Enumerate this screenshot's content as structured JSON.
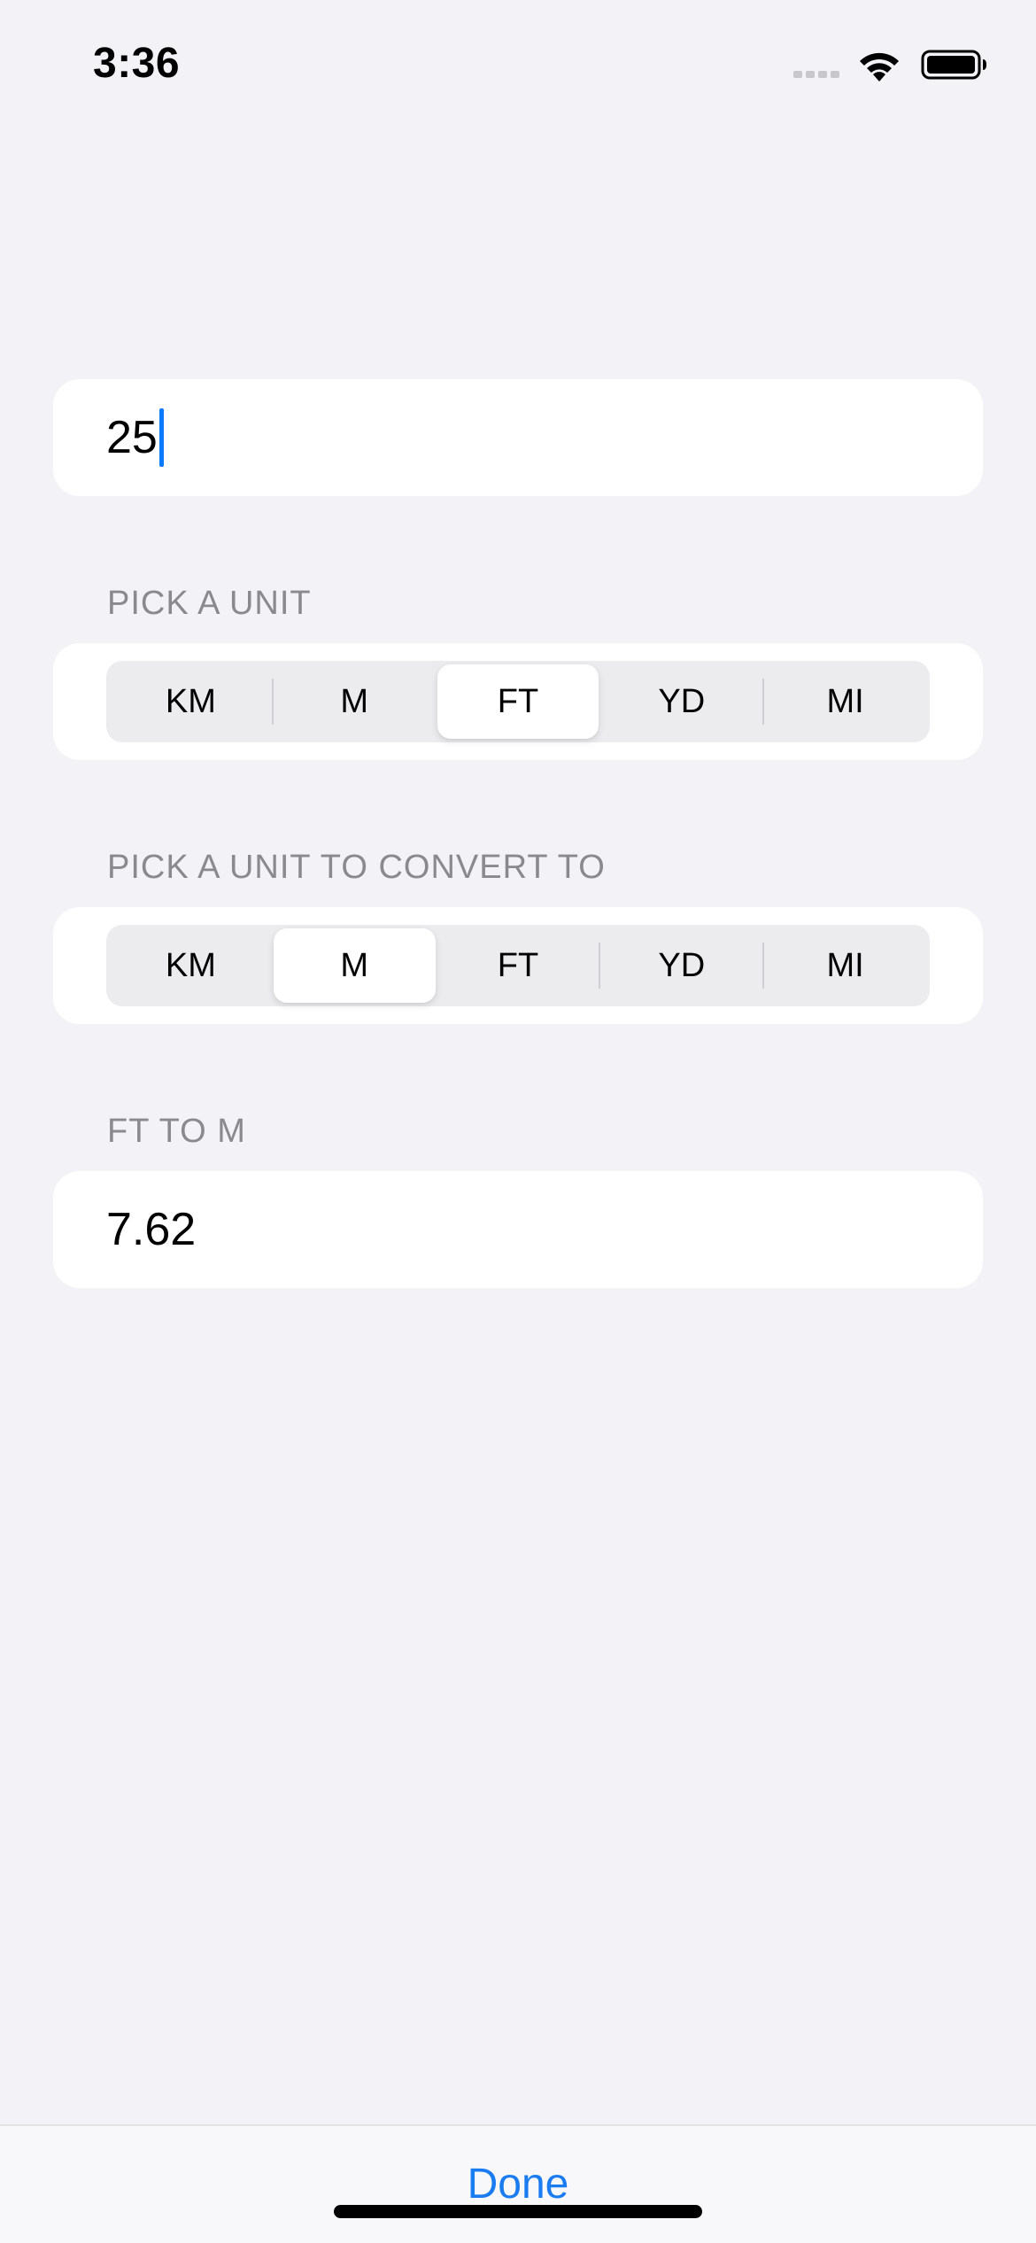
{
  "status_bar": {
    "time": "3:36",
    "icons": [
      "cellular-signal-icon",
      "wifi-icon",
      "battery-icon"
    ]
  },
  "input": {
    "value": "25"
  },
  "from_unit": {
    "header": "PICK A UNIT",
    "options": [
      "KM",
      "M",
      "FT",
      "YD",
      "MI"
    ],
    "selected": "FT"
  },
  "to_unit": {
    "header": "PICK A UNIT TO CONVERT TO",
    "options": [
      "KM",
      "M",
      "FT",
      "YD",
      "MI"
    ],
    "selected": "M"
  },
  "result": {
    "header": "FT TO M",
    "value": "7.62"
  },
  "toolbar": {
    "done_label": "Done"
  },
  "colors": {
    "background": "#f2f2f7",
    "accent": "#1a7cf0",
    "secondary_text": "#8a8a8e"
  }
}
